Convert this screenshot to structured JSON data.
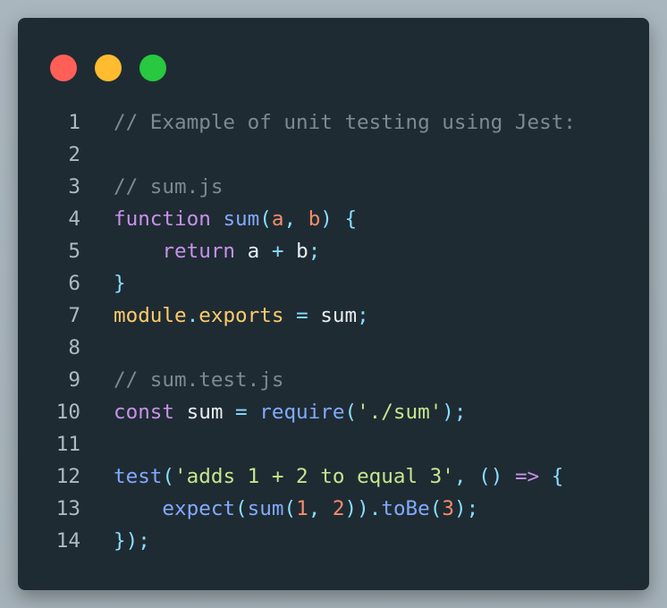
{
  "window": {
    "controls": [
      {
        "name": "close",
        "color": "#ff5f57"
      },
      {
        "name": "minimize",
        "color": "#febc2e"
      },
      {
        "name": "maximize",
        "color": "#28c840"
      }
    ]
  },
  "code": {
    "lines": [
      {
        "number": "1",
        "tokens": [
          {
            "text": "// Example of unit testing using Jest:",
            "type": "comment"
          }
        ]
      },
      {
        "number": "2",
        "tokens": []
      },
      {
        "number": "3",
        "tokens": [
          {
            "text": "// sum.js",
            "type": "comment"
          }
        ]
      },
      {
        "number": "4",
        "tokens": [
          {
            "text": "function",
            "type": "kw"
          },
          {
            "text": " ",
            "type": "ident"
          },
          {
            "text": "sum",
            "type": "fn"
          },
          {
            "text": "(",
            "type": "punc"
          },
          {
            "text": "a",
            "type": "param"
          },
          {
            "text": ", ",
            "type": "punc"
          },
          {
            "text": "b",
            "type": "param"
          },
          {
            "text": ") {",
            "type": "punc"
          }
        ]
      },
      {
        "number": "5",
        "tokens": [
          {
            "text": "    ",
            "type": "ident"
          },
          {
            "text": "return",
            "type": "kw"
          },
          {
            "text": " a ",
            "type": "ident"
          },
          {
            "text": "+",
            "type": "punc"
          },
          {
            "text": " b",
            "type": "ident"
          },
          {
            "text": ";",
            "type": "punc"
          }
        ]
      },
      {
        "number": "6",
        "tokens": [
          {
            "text": "}",
            "type": "punc"
          }
        ]
      },
      {
        "number": "7",
        "tokens": [
          {
            "text": "module",
            "type": "mod"
          },
          {
            "text": ".",
            "type": "punc"
          },
          {
            "text": "exports",
            "type": "mod"
          },
          {
            "text": " ",
            "type": "ident"
          },
          {
            "text": "=",
            "type": "punc"
          },
          {
            "text": " sum",
            "type": "ident"
          },
          {
            "text": ";",
            "type": "punc"
          }
        ]
      },
      {
        "number": "8",
        "tokens": []
      },
      {
        "number": "9",
        "tokens": [
          {
            "text": "// sum.test.js",
            "type": "comment"
          }
        ]
      },
      {
        "number": "10",
        "tokens": [
          {
            "text": "const",
            "type": "kw"
          },
          {
            "text": " sum ",
            "type": "ident"
          },
          {
            "text": "=",
            "type": "punc"
          },
          {
            "text": " ",
            "type": "ident"
          },
          {
            "text": "require",
            "type": "fn"
          },
          {
            "text": "(",
            "type": "punc"
          },
          {
            "text": "'./sum'",
            "type": "str"
          },
          {
            "text": ");",
            "type": "punc"
          }
        ]
      },
      {
        "number": "11",
        "tokens": []
      },
      {
        "number": "12",
        "tokens": [
          {
            "text": "test",
            "type": "fn"
          },
          {
            "text": "(",
            "type": "punc"
          },
          {
            "text": "'adds 1 + 2 to equal 3'",
            "type": "str"
          },
          {
            "text": ", ",
            "type": "punc"
          },
          {
            "text": "()",
            "type": "punc"
          },
          {
            "text": " ",
            "type": "ident"
          },
          {
            "text": "=>",
            "type": "kw"
          },
          {
            "text": " {",
            "type": "punc"
          }
        ]
      },
      {
        "number": "13",
        "tokens": [
          {
            "text": "    ",
            "type": "ident"
          },
          {
            "text": "expect",
            "type": "fn"
          },
          {
            "text": "(",
            "type": "punc"
          },
          {
            "text": "sum",
            "type": "fn"
          },
          {
            "text": "(",
            "type": "punc"
          },
          {
            "text": "1",
            "type": "num"
          },
          {
            "text": ", ",
            "type": "punc"
          },
          {
            "text": "2",
            "type": "num"
          },
          {
            "text": "))",
            "type": "punc"
          },
          {
            "text": ".",
            "type": "punc"
          },
          {
            "text": "toBe",
            "type": "fn"
          },
          {
            "text": "(",
            "type": "punc"
          },
          {
            "text": "3",
            "type": "num"
          },
          {
            "text": ");",
            "type": "punc"
          }
        ]
      },
      {
        "number": "14",
        "tokens": [
          {
            "text": "});",
            "type": "punc"
          }
        ]
      }
    ]
  }
}
